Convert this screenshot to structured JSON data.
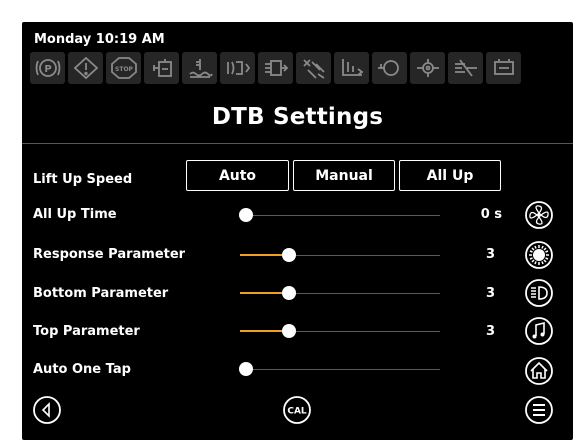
{
  "status": {
    "datetime": "Monday 10:19 AM"
  },
  "warning_icons": [
    {
      "name": "parking-brake-icon"
    },
    {
      "name": "warning-triangle-icon"
    },
    {
      "name": "stop-icon",
      "label": "STOP"
    },
    {
      "name": "fuel-filter-icon"
    },
    {
      "name": "coolant-level-icon"
    },
    {
      "name": "engine-preheat-icon"
    },
    {
      "name": "hydraulic-icon"
    },
    {
      "name": "filter-clog-icon"
    },
    {
      "name": "transmission-icon"
    },
    {
      "name": "oil-pressure-icon"
    },
    {
      "name": "gear-temp-icon"
    },
    {
      "name": "pto-icon"
    },
    {
      "name": "battery-icon"
    }
  ],
  "page": {
    "title": "DTB Settings"
  },
  "lift_up_speed": {
    "label": "Lift Up Speed",
    "options": [
      "Auto",
      "Manual",
      "All Up"
    ]
  },
  "settings": [
    {
      "label": "All Up Time",
      "value": "0 s",
      "level": 0.0
    },
    {
      "label": "Response Parameter",
      "value": "3",
      "level": 0.25
    },
    {
      "label": "Bottom Parameter",
      "value": "3",
      "level": 0.25
    },
    {
      "label": "Top Parameter",
      "value": "3",
      "level": 0.25
    },
    {
      "label": "Auto One Tap",
      "value": "",
      "level": 0.0
    }
  ],
  "side_icons": [
    "fan-icon",
    "work-light-icon",
    "headlight-icon",
    "music-icon",
    "home-icon"
  ],
  "bottom": {
    "cal_label": "CAL"
  },
  "colors": {
    "background": "#000000",
    "slider_fill": "#f0a020",
    "foreground": "#ffffff"
  }
}
